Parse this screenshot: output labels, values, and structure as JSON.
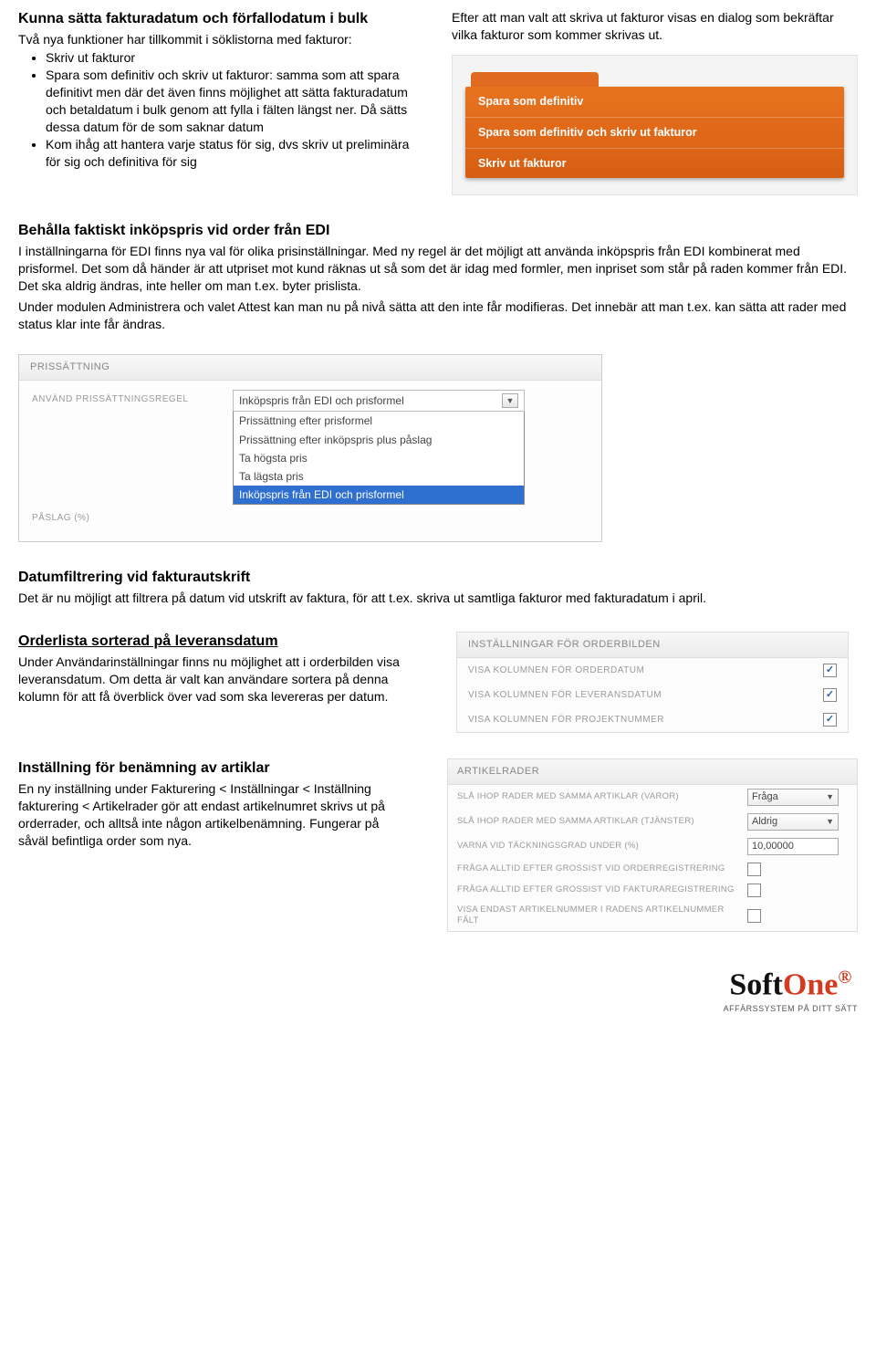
{
  "sec1": {
    "title": "Kunna sätta fakturadatum och förfallodatum i bulk",
    "intro": "Två nya funktioner har tillkommit i söklistorna med fakturor:",
    "bullets": [
      "Skriv ut fakturor",
      "Spara som definitiv och skriv ut fakturor: samma som att spara definitivt men där det även finns möjlighet att sätta fakturadatum och betaldatum i bulk genom att fylla i fälten längst ner. Då sätts dessa datum för de som saknar datum",
      "Kom ihåg att hantera varje status för sig, dvs skriv ut preliminära för sig och definitiva för sig"
    ],
    "right_text": "Efter att man valt att skriva ut fakturor visas en dialog som bekräftar vilka fakturor som kommer skrivas ut.",
    "menu": {
      "item1": "Spara som definitiv",
      "item2": "Spara som definitiv och skriv ut fakturor",
      "item3": "Skriv ut fakturor"
    }
  },
  "sec2": {
    "title": "Behålla faktiskt inköpspris vid order från EDI",
    "p1": "I inställningarna för EDI finns nya val för olika prisinställningar. Med ny regel är det möjligt att använda inköpspris från EDI kombinerat med prisformel. Det som då händer är att utpriset mot kund räknas ut så som det är idag med formler, men inpriset som står på raden kommer från EDI. Det ska aldrig ändras, inte heller om man t.ex. byter prislista.",
    "p2": "Under modulen Administrera och valet Attest kan man nu på nivå sätta att den inte får modifieras. Det innebär att man t.ex. kan sätta att rader med status klar inte får ändras.",
    "panel_title": "PRISSÄTTNING",
    "label_rule": "ANVÄND PRISSÄTTNINGSREGEL",
    "label_markup": "PÅSLAG (%)",
    "dropdown": {
      "selected": "Inköpspris från EDI och prisformel",
      "opts": [
        "Prissättning efter prisformel",
        "Prissättning efter inköpspris plus påslag",
        "Ta högsta pris",
        "Ta lägsta pris",
        "Inköpspris från EDI och prisformel"
      ]
    }
  },
  "sec3": {
    "title": "Datumfiltrering vid fakturautskrift",
    "p": "Det är nu möjligt att filtrera på datum vid utskrift av faktura, för att t.ex. skriva ut samtliga fakturor med fakturadatum i april."
  },
  "sec4": {
    "title": "Orderlista sorterad på leveransdatum",
    "p": "Under Användarinställningar finns nu möjlighet att i orderbilden visa leveransdatum. Om detta är valt kan användare sortera på denna kolumn för att få överblick över vad som ska levereras per datum.",
    "panel_title": "INSTÄLLNINGAR FÖR ORDERBILDEN",
    "rows": [
      "VISA KOLUMNEN FÖR ORDERDATUM",
      "VISA KOLUMNEN FÖR LEVERANSDATUM",
      "VISA KOLUMNEN FÖR PROJEKTNUMMER"
    ]
  },
  "sec5": {
    "title": "Inställning för benämning av artiklar",
    "p": "En ny inställning under Fakturering < Inställningar < Inställning fakturering < Artikelrader gör att endast artikelnumret skrivs ut på orderrader, och alltså inte någon artikelbenämning. Fungerar på såväl befintliga order som nya.",
    "panel_title": "ARTIKELRADER",
    "rows": {
      "r0": {
        "label": "SLÅ IHOP RADER MED SAMMA ARTIKLAR (VAROR)",
        "value": "Fråga"
      },
      "r1": {
        "label": "SLÅ IHOP RADER MED SAMMA ARTIKLAR (TJÄNSTER)",
        "value": "Aldrig"
      },
      "r2": {
        "label": "VARNA VID TÄCKNINGSGRAD UNDER (%)",
        "value": "10,00000"
      },
      "r3": {
        "label": "FRÅGA ALLTID EFTER GROSSIST VID ORDERREGISTRERING"
      },
      "r4": {
        "label": "FRÅGA ALLTID EFTER GROSSIST VID FAKTURAREGISTRERING"
      },
      "r5": {
        "label": "VISA ENDAST ARTIKELNUMMER I RADENS ARTIKELNUMMER FÄLT"
      }
    }
  },
  "footer": {
    "brand_a": "Soft",
    "brand_b": "One",
    "tagline": "AFFÄRSSYSTEM PÅ DITT SÄTT"
  }
}
